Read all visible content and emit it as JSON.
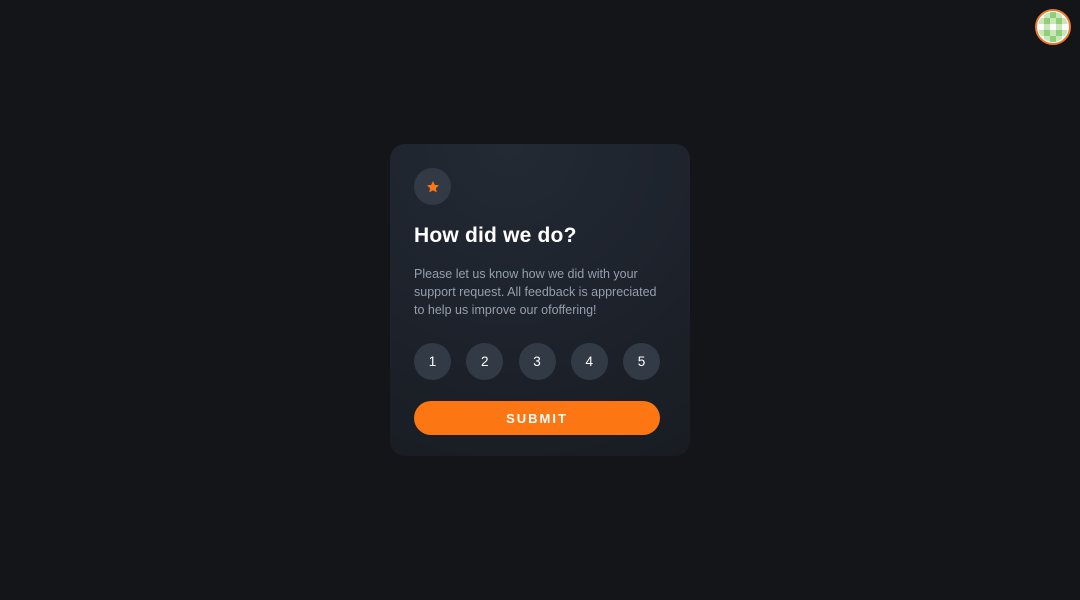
{
  "avatar": {
    "icon": "checkered-avatar-icon",
    "colors": {
      "border": "#f0782a",
      "tile_light": "#c9e8b8",
      "tile_dark": "#8fcf7a"
    }
  },
  "card": {
    "icon": "star-icon",
    "title": "How did we do?",
    "description": "Please let us know how we did with your support request. All feedback is appreciated to help us improve our ofoffering!",
    "ratings": [
      "1",
      "2",
      "3",
      "4",
      "5"
    ],
    "submit_label": "SUBMIT"
  },
  "colors": {
    "background": "#131518",
    "card": "#1f242c",
    "accent": "#fc7613",
    "circle": "#323a46",
    "body_text": "#969fad",
    "heading": "#ffffff"
  }
}
